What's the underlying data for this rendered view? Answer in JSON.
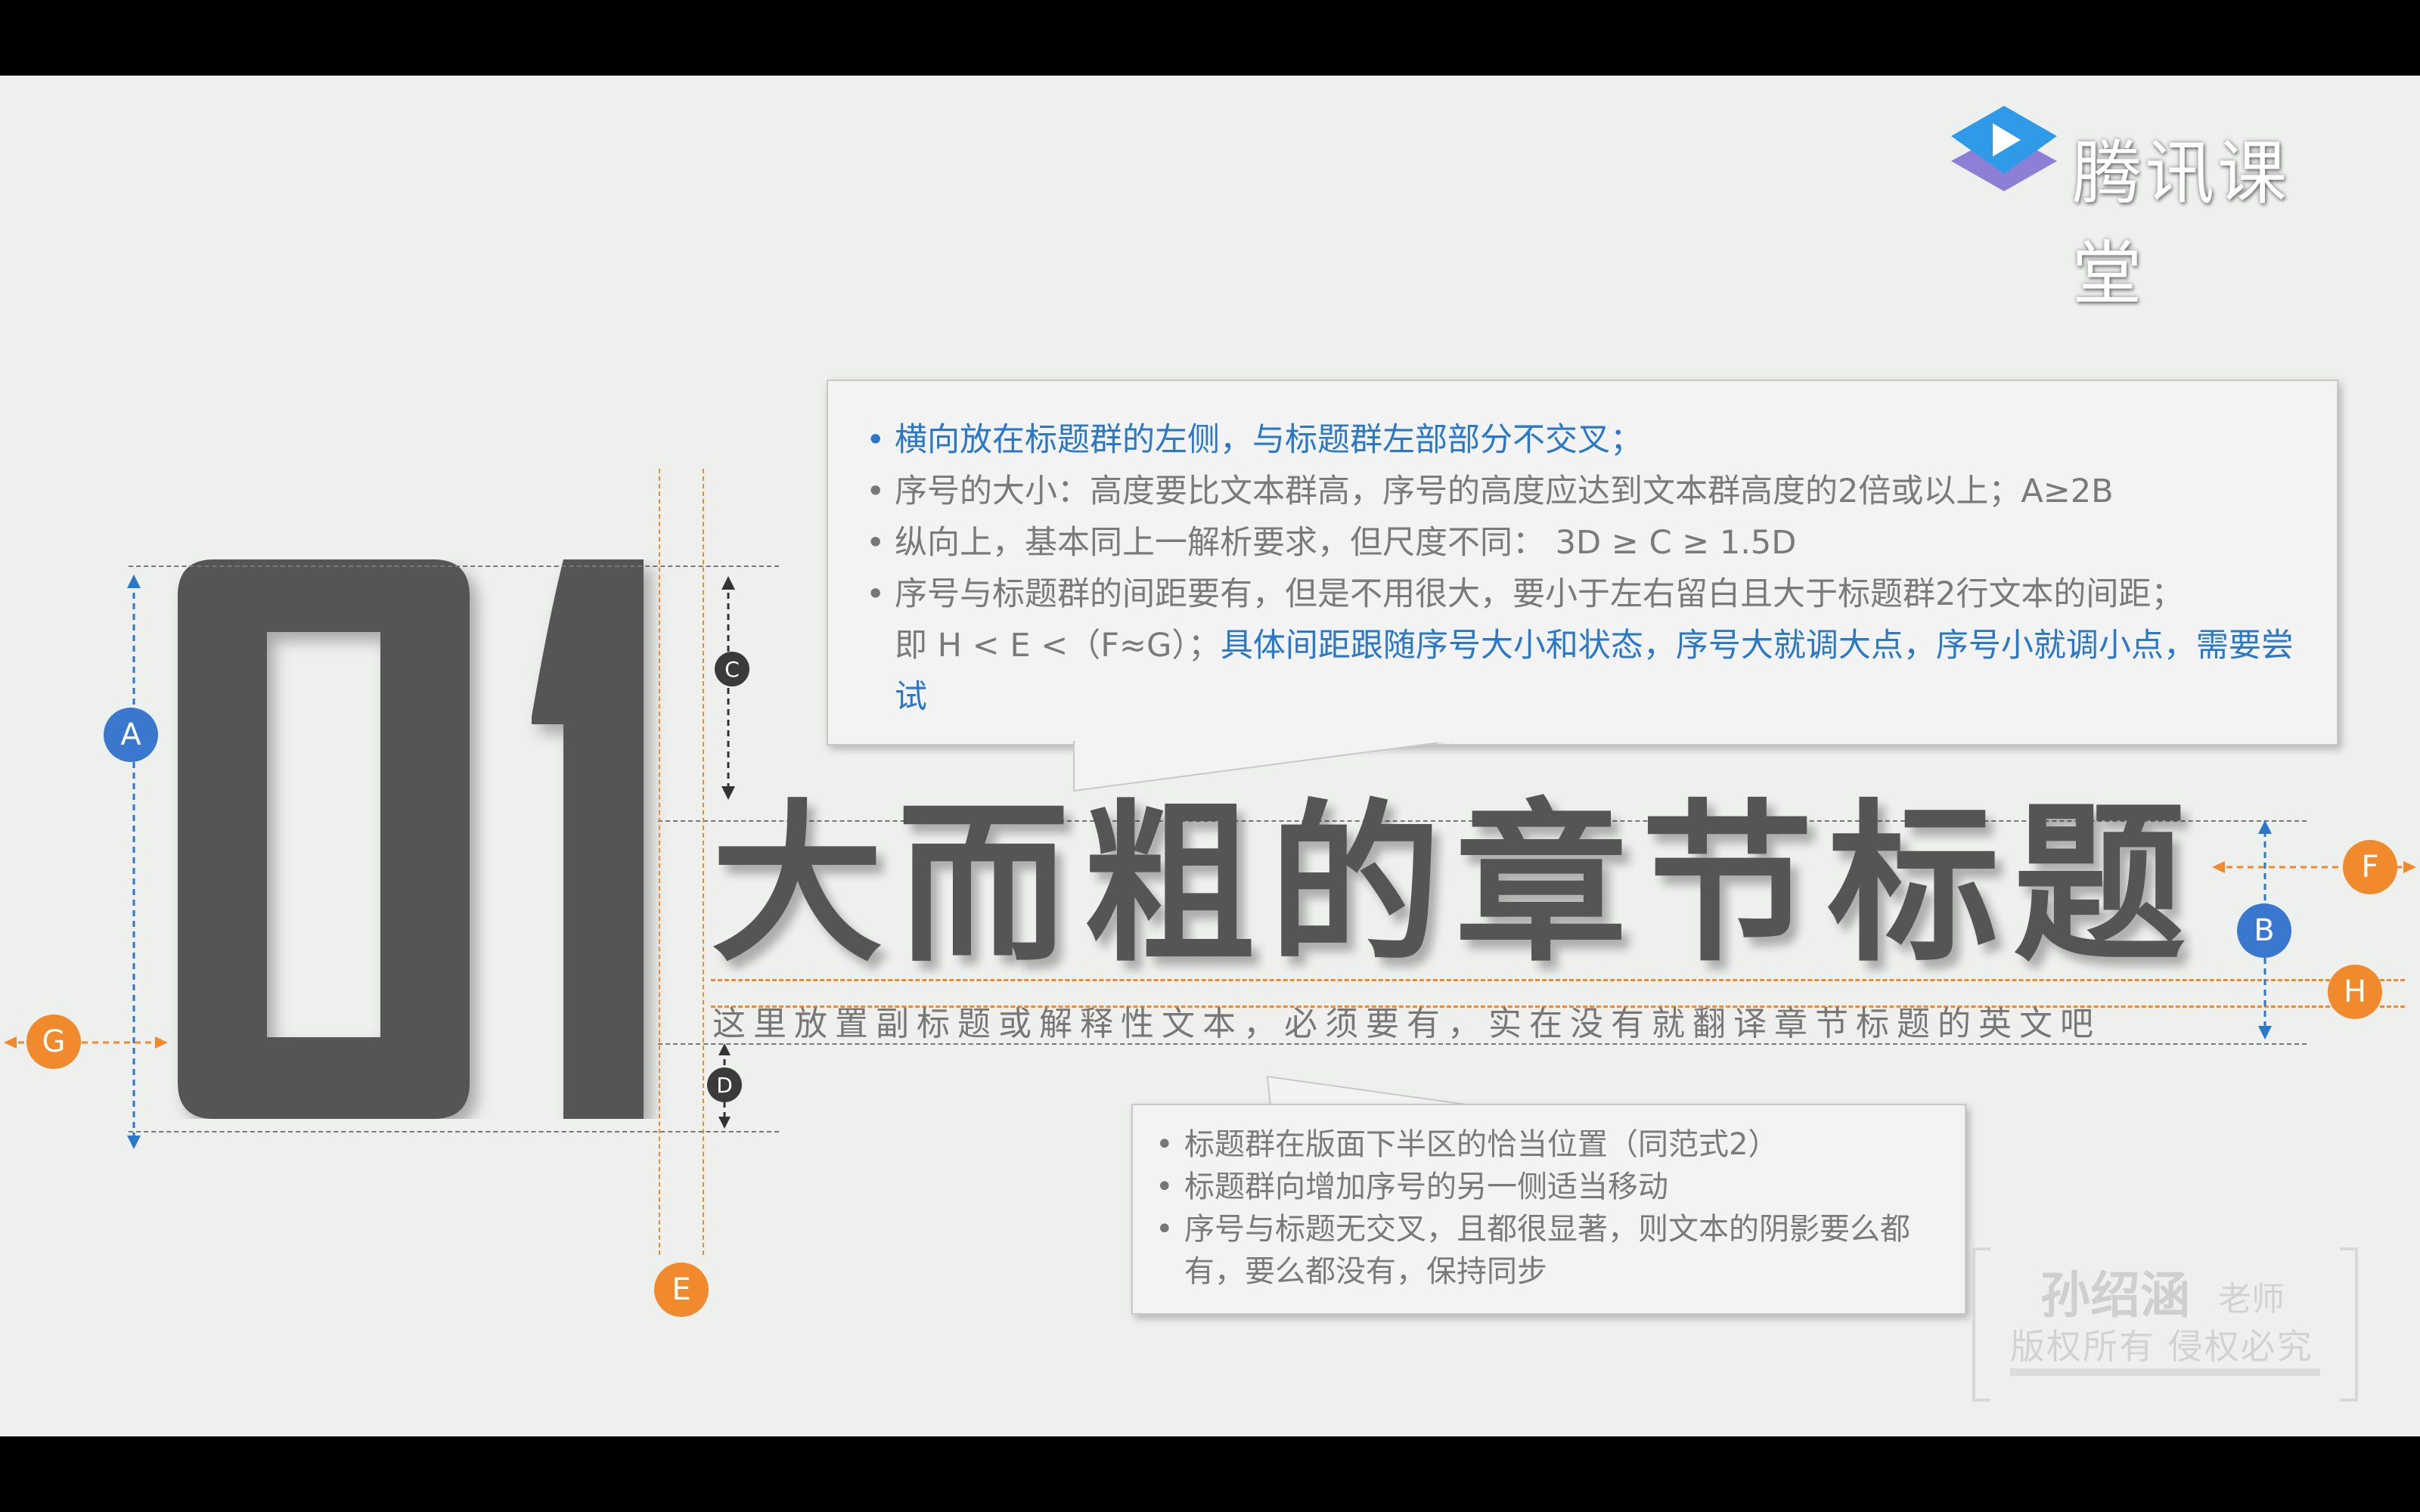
{
  "logo": {
    "text": "腾讯课堂",
    "icon": "play-icon"
  },
  "big_number": "01",
  "title": "大而粗的章节标题",
  "subtitle": "这里放置副标题或解释性文本，必须要有，实在没有就翻译章节标题的英文吧",
  "callout_top": {
    "items": [
      "横向放在标题群的左侧，与标题群左部部分不交叉；",
      "序号的大小：高度要比文本群高，序号的高度应达到文本群高度的2倍或以上；A≥2B",
      "纵向上，基本同上一解析要求，但尺度不同： 3D ≥ C ≥ 1.5D"
    ],
    "item4_gray": "序号与标题群的间距要有，但是不用很大，要小于左右留白且大于标题群2行文本的间距；",
    "item4_line2_gray": "即 H < E <（F≈G）；",
    "item4_line2_blue": "具体间距跟随序号大小和状态，序号大就调大点，序号小就调小点，需要尝试"
  },
  "callout_bottom": {
    "items": [
      "标题群在版面下半区的恰当位置（同范式2）",
      "标题群向增加序号的另一侧适当移动",
      "序号与标题无交叉，且都很显著，则文本的阴影要么都有，要么都没有，保持同步"
    ]
  },
  "markers": {
    "A": "A",
    "B": "B",
    "C": "C",
    "D": "D",
    "E": "E",
    "F": "F",
    "G": "G",
    "H": "H"
  },
  "watermark": {
    "name": "孙绍涵",
    "role": "老师",
    "copyright": "版权所有 侵权必究"
  },
  "colors": {
    "blue": "#3a78d0",
    "orange": "#f08a2c",
    "dark": "#555555",
    "background": "#eef0ee"
  }
}
